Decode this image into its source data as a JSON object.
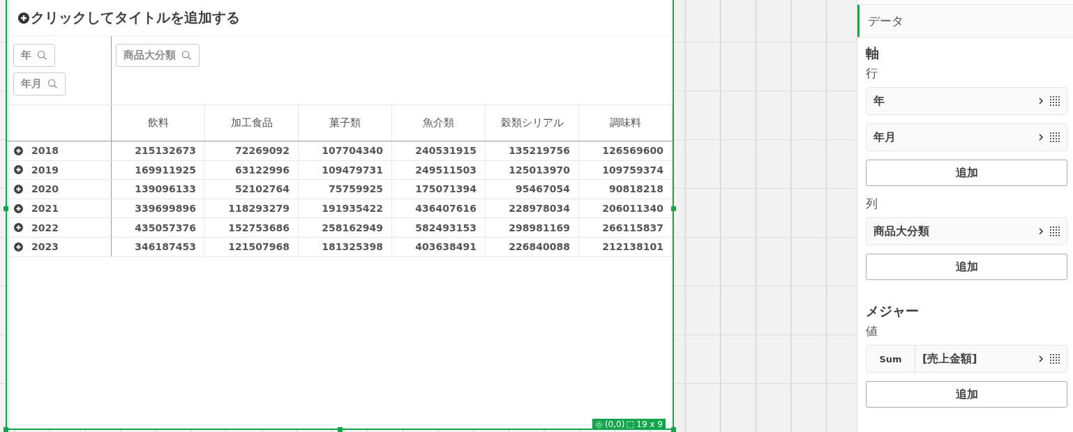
{
  "object": {
    "title": "クリックしてタイトルを追加する",
    "row_filters": [
      {
        "label": "年"
      },
      {
        "label": "年月"
      }
    ],
    "column_filters": [
      {
        "label": "商品大分類"
      }
    ],
    "columns": [
      "飲料",
      "加工食品",
      "菓子類",
      "魚介類",
      "穀類シリアル",
      "調味料"
    ],
    "rows": [
      {
        "label": "2018",
        "expanded": false,
        "values": [
          "215132673",
          "72269092",
          "107704340",
          "240531915",
          "135219756",
          "126569600"
        ]
      },
      {
        "label": "2019",
        "expanded": false,
        "values": [
          "169911925",
          "63122996",
          "109479731",
          "249511503",
          "125013970",
          "109759374"
        ]
      },
      {
        "label": "2020",
        "expanded": false,
        "values": [
          "139096133",
          "52102764",
          "75759925",
          "175071394",
          "95467054",
          "90818218"
        ]
      },
      {
        "label": "2021",
        "expanded": false,
        "values": [
          "339699896",
          "118293279",
          "191935422",
          "436407616",
          "228978034",
          "206011340"
        ]
      },
      {
        "label": "2022",
        "expanded": false,
        "values": [
          "435057376",
          "152753686",
          "258162949",
          "582493153",
          "298981169",
          "266115837"
        ]
      },
      {
        "label": "2023",
        "expanded": false,
        "values": [
          "346187453",
          "121507968",
          "181325398",
          "403638491",
          "226840088",
          "212138101"
        ]
      }
    ],
    "badge": {
      "position": "(0,0)",
      "size": "19 x 9"
    }
  },
  "panel": {
    "tabs": [
      {
        "label": "データ",
        "selected": true
      }
    ],
    "sections": [
      {
        "heading": "軸",
        "groups": [
          {
            "label": "行",
            "items": [
              {
                "kind": "field",
                "label": "年"
              },
              {
                "kind": "field",
                "label": "年月"
              }
            ],
            "add_button": "追加"
          },
          {
            "label": "列",
            "items": [
              {
                "kind": "field",
                "label": "商品大分類"
              }
            ],
            "add_button": "追加"
          }
        ]
      },
      {
        "heading": "メジャー",
        "groups": [
          {
            "label": "値",
            "items": [
              {
                "kind": "measure",
                "aggregation": "Sum",
                "label": "[売上金額]"
              }
            ],
            "add_button": "追加"
          }
        ]
      }
    ]
  }
}
